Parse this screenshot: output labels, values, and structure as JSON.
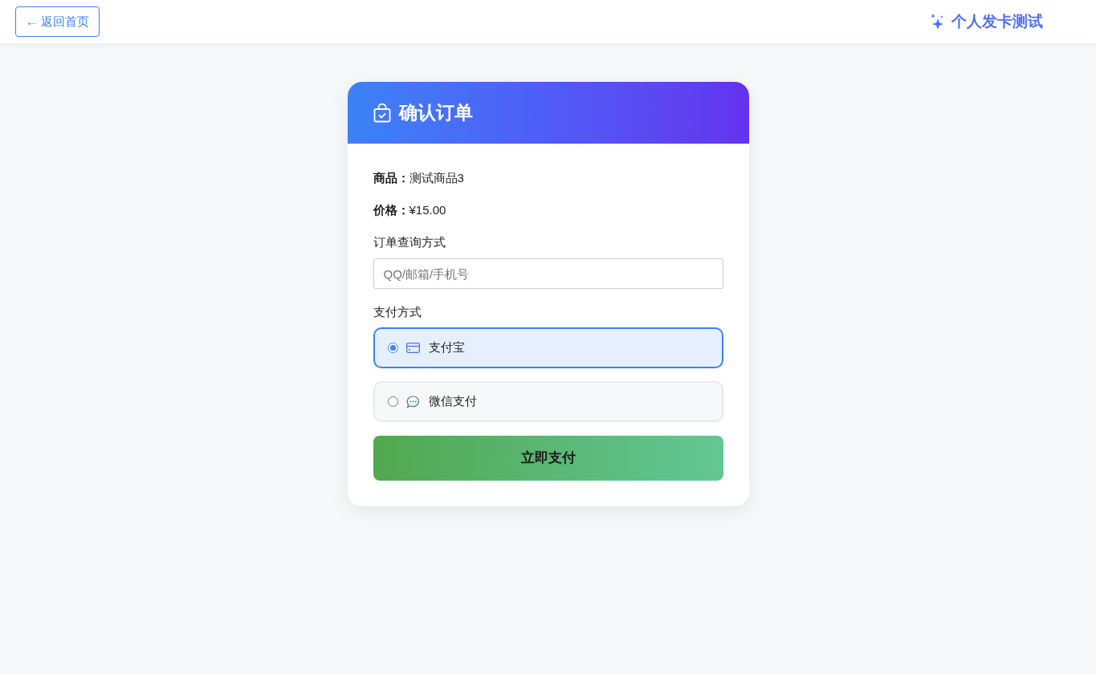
{
  "topbar": {
    "back_button": "← 返回首页",
    "brand": "个人发卡测试"
  },
  "order_card": {
    "title": "确认订单",
    "fields": [
      {
        "label": "商品：",
        "value": "测试商品3"
      },
      {
        "label": "价格：",
        "value": "¥15.00"
      }
    ],
    "query_label": "订单查询方式",
    "query_input": {
      "placeholder": "QQ/邮箱/手机号"
    },
    "payment_label": "支付方式",
    "payment_options": [
      {
        "label": "支付宝",
        "kind": "card",
        "selected": true
      },
      {
        "label": "微信支付",
        "kind": "chat",
        "selected": false
      }
    ],
    "pay_button": "立即支付"
  }
}
